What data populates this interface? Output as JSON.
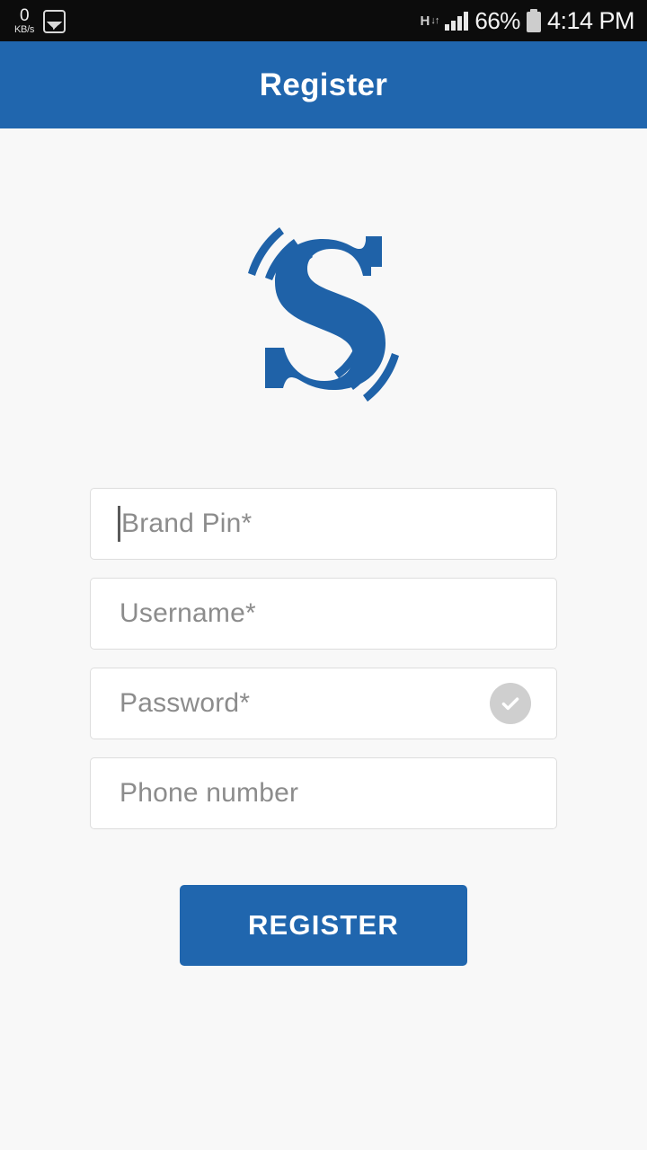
{
  "status_bar": {
    "network_speed_value": "0",
    "network_speed_unit": "KB/s",
    "gallery_icon": "photo-icon",
    "data_type": "H",
    "data_arrows": "↓↑",
    "signal_icon": "signal-bars-icon",
    "battery_percent": "66%",
    "battery_icon": "battery-icon",
    "time": "4:14 PM"
  },
  "app_bar": {
    "title": "Register"
  },
  "logo": {
    "letter": "S",
    "name": "brand-logo-s",
    "color": "#1f62a8"
  },
  "form": {
    "fields": [
      {
        "name": "brand-pin",
        "placeholder": "Brand Pin*",
        "value": "",
        "focused": true
      },
      {
        "name": "username",
        "placeholder": "Username*",
        "value": "",
        "focused": false
      },
      {
        "name": "password",
        "placeholder": "Password*",
        "value": "",
        "focused": false
      },
      {
        "name": "phone-number",
        "placeholder": "Phone number",
        "value": "",
        "focused": false
      }
    ],
    "password_toggle_icon": "check-circle-icon",
    "submit_label": "REGISTER"
  },
  "colors": {
    "primary": "#2066ae",
    "page_background": "#f8f8f8",
    "field_border": "#dddddd",
    "placeholder": "#8c8c8c",
    "status_bar": "#0c0c0c"
  }
}
